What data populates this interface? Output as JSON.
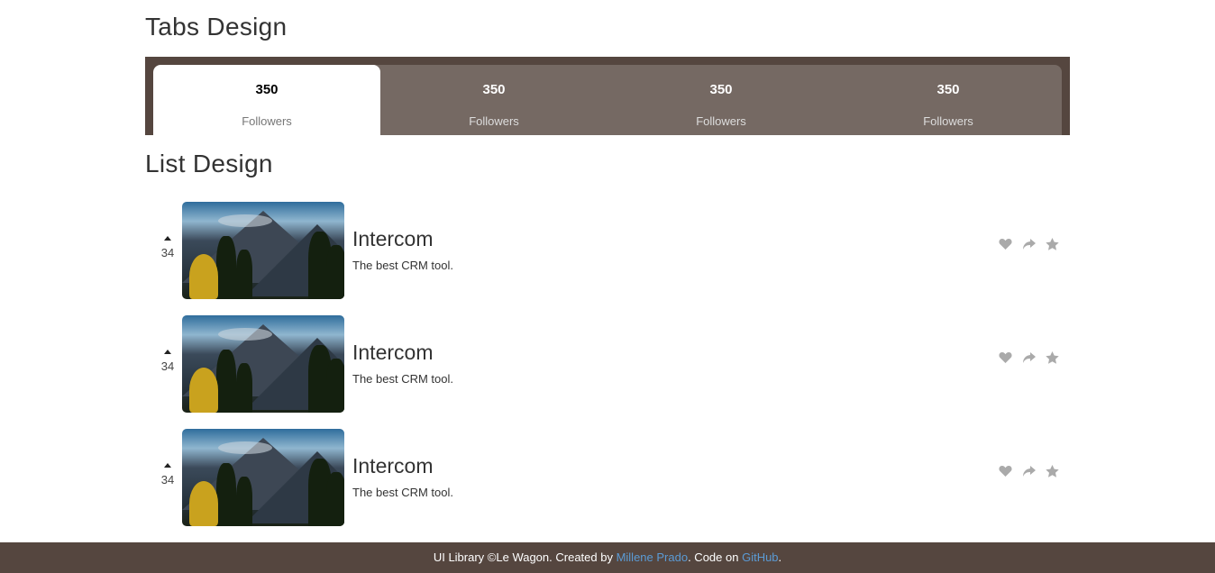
{
  "sections": {
    "tabs_title": "Tabs Design",
    "list_title": "List Design"
  },
  "tabs": [
    {
      "count": "350",
      "label": "Followers",
      "active": true
    },
    {
      "count": "350",
      "label": "Followers",
      "active": false
    },
    {
      "count": "350",
      "label": "Followers",
      "active": false
    },
    {
      "count": "350",
      "label": "Followers",
      "active": false
    }
  ],
  "list": [
    {
      "votes": "34",
      "title": "Intercom",
      "desc": "The best CRM tool.",
      "actions": [
        "heart-icon",
        "share-icon",
        "star-icon"
      ]
    },
    {
      "votes": "34",
      "title": "Intercom",
      "desc": "The best CRM tool.",
      "actions": [
        "heart-icon",
        "share-icon",
        "star-icon"
      ]
    },
    {
      "votes": "34",
      "title": "Intercom",
      "desc": "The best CRM tool.",
      "actions": [
        "heart-icon",
        "share-icon",
        "star-icon"
      ]
    }
  ],
  "footer": {
    "prefix": "UI Library ©Le Wagon. Created by ",
    "author": "Millene Prado",
    "middle": ". Code on ",
    "code_link": "GitHub",
    "suffix": "."
  },
  "colors": {
    "brand_dark": "#55463f",
    "tab_inactive": "#756963",
    "link": "#5b9bd5",
    "icon": "#aaaaaa"
  }
}
